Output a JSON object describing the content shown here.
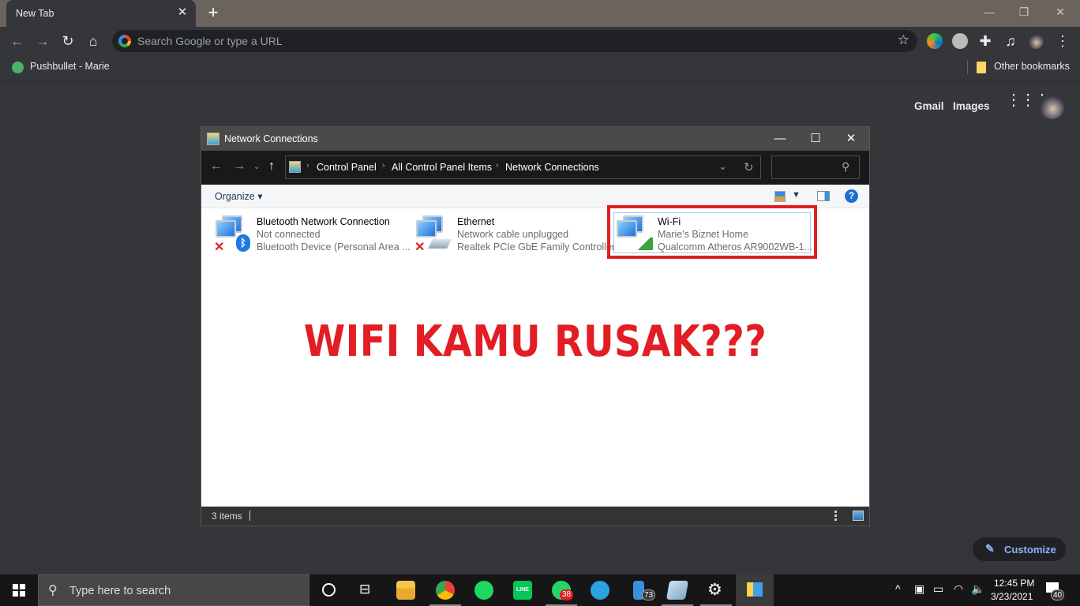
{
  "browser": {
    "tab_title": "New Tab",
    "omnibox_placeholder": "Search Google or type a URL",
    "bookmarks": [
      {
        "label": "Pushbullet - Marie"
      },
      {
        "label": "Other bookmarks"
      }
    ],
    "ntp": {
      "gmail": "Gmail",
      "images": "Images",
      "customize": "Customize"
    }
  },
  "explorer": {
    "title": "Network Connections",
    "breadcrumbs": [
      "Control Panel",
      "All Control Panel Items",
      "Network Connections"
    ],
    "organize": "Organize",
    "items": [
      {
        "name": "Bluetooth Network Connection",
        "status": "Not connected",
        "device": "Bluetooth Device (Personal Area ..."
      },
      {
        "name": "Ethernet",
        "status": "Network cable unplugged",
        "device": "Realtek PCIe GbE Family Controller"
      },
      {
        "name": "Wi-Fi",
        "status": "Marie's Biznet Home",
        "device": "Qualcomm Atheros AR9002WB-1..."
      }
    ],
    "status_bar": "3 items"
  },
  "overlay": {
    "headline": "WIFI KAMU RUSAK???",
    "color": "#e21d24"
  },
  "taskbar": {
    "search_placeholder": "Type here to search",
    "badges": {
      "whatsapp": "38",
      "phone": "73",
      "notifications": "40"
    },
    "time": "12:45 PM",
    "date": "3/23/2021"
  }
}
